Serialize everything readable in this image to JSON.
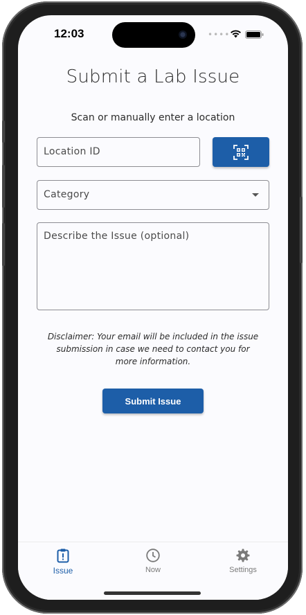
{
  "status_bar": {
    "time": "12:03"
  },
  "page": {
    "title": "Submit a Lab Issue",
    "subtitle": "Scan or manually enter a location"
  },
  "form": {
    "location_placeholder": "Location ID",
    "category_placeholder": "Category",
    "description_placeholder": "Describe the Issue (optional)",
    "disclaimer": "Disclaimer: Your email will be included in the issue submission in case we need to contact you for more information.",
    "submit_label": "Submit Issue",
    "scan_icon": "qr-code-scan-icon"
  },
  "tab_bar": {
    "active": "issue",
    "items": [
      {
        "label": "Issue",
        "icon": "clipboard-alert-icon"
      },
      {
        "label": "Now",
        "icon": "clock-icon"
      },
      {
        "label": "Settings",
        "icon": "gear-icon"
      }
    ]
  },
  "colors": {
    "accent": "#1d5ea8",
    "background": "#fbfbfe",
    "text": "#2b2b2b",
    "inactive": "#7a7a7a"
  }
}
